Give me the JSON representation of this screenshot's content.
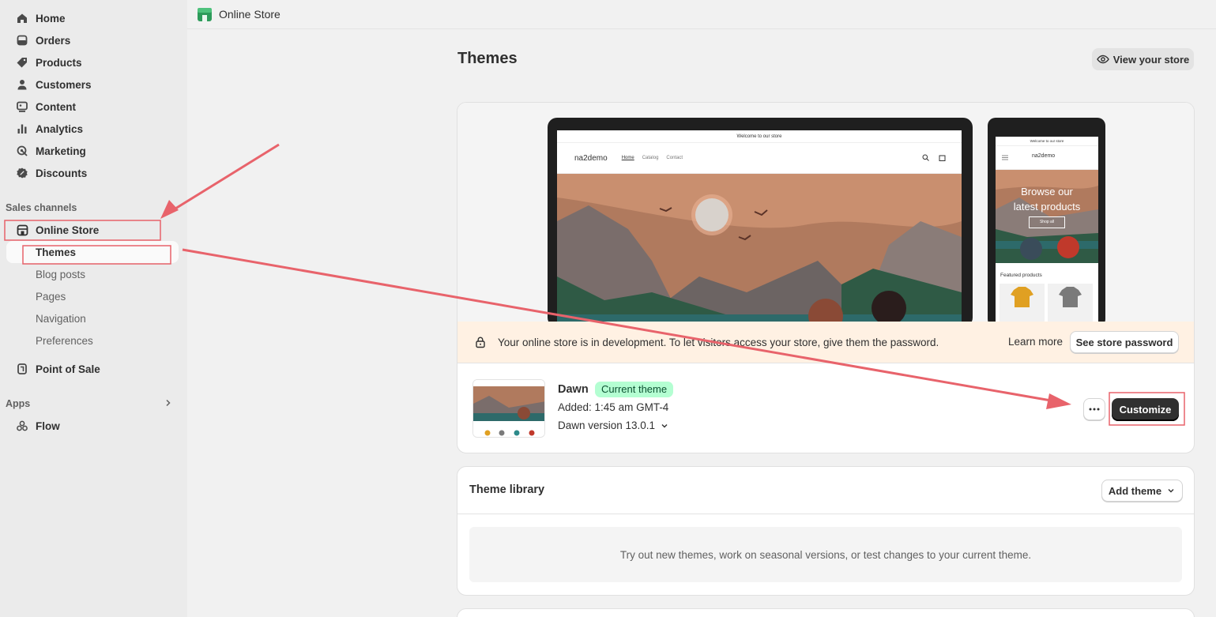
{
  "sidebar": {
    "items": [
      {
        "label": "Home",
        "icon": "home-icon"
      },
      {
        "label": "Orders",
        "icon": "orders-icon"
      },
      {
        "label": "Products",
        "icon": "tag-icon"
      },
      {
        "label": "Customers",
        "icon": "person-icon"
      },
      {
        "label": "Content",
        "icon": "content-icon"
      },
      {
        "label": "Analytics",
        "icon": "bar-chart-icon"
      },
      {
        "label": "Marketing",
        "icon": "target-icon"
      },
      {
        "label": "Discounts",
        "icon": "discount-icon"
      }
    ],
    "sales_channels_heading": "Sales channels",
    "online_store": "Online Store",
    "sub_items": [
      "Themes",
      "Blog posts",
      "Pages",
      "Navigation",
      "Preferences"
    ],
    "point_of_sale": "Point of Sale",
    "apps_heading": "Apps",
    "flow": "Flow"
  },
  "topbar": {
    "title": "Online Store"
  },
  "page": {
    "title": "Themes",
    "view_store": "View your store"
  },
  "preview": {
    "announcement": "Welcome to our store",
    "brand": "na2demo",
    "links": [
      "Home",
      "Catalog",
      "Contact"
    ],
    "phone_announcement": "Welcome to our store",
    "phone_hero_line1": "Browse our",
    "phone_hero_line2": "latest products",
    "phone_shop_all": "Shop all",
    "phone_featured": "Featured products"
  },
  "banner": {
    "message": "Your online store is in development. To let visitors access your store, give them the password.",
    "learn_more": "Learn more",
    "see_password": "See store password"
  },
  "current_theme": {
    "name": "Dawn",
    "badge": "Current theme",
    "added": "Added: 1:45 am GMT-4",
    "version": "Dawn version 13.0.1",
    "customize": "Customize"
  },
  "library": {
    "title": "Theme library",
    "add_theme": "Add theme",
    "empty": "Try out new themes, work on seasonal versions, or test changes to your current theme."
  },
  "colors": {
    "accent": "#303030",
    "badge_bg": "#b4fed2",
    "banner_bg": "#fff1e3",
    "annotation": "#e8636b"
  }
}
